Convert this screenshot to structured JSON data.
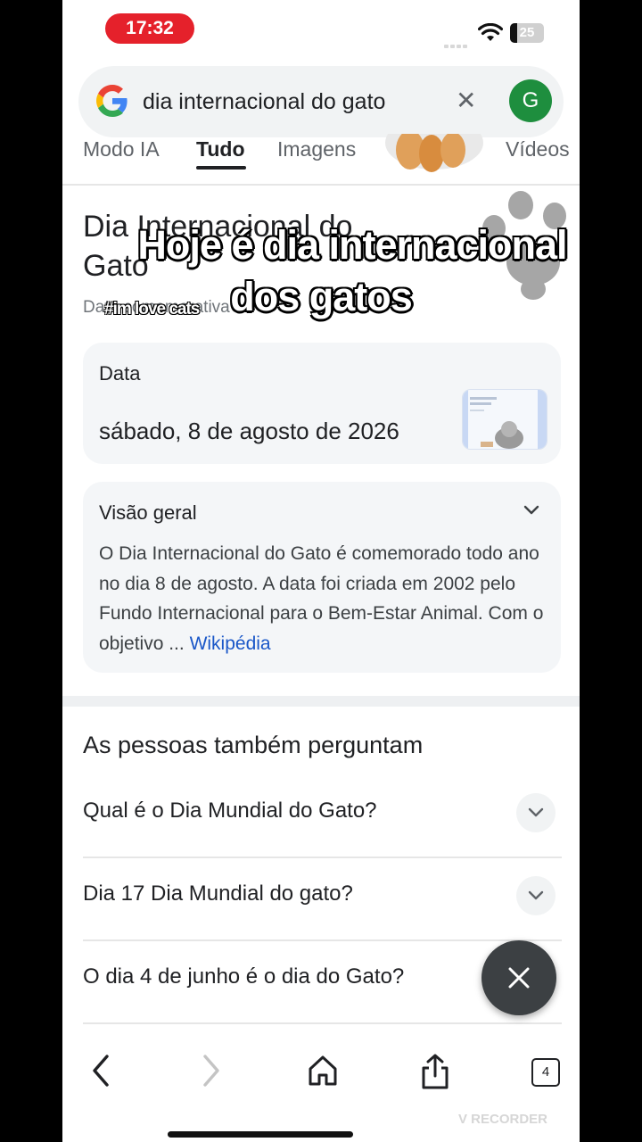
{
  "status_bar": {
    "time": "17:32",
    "battery": "25"
  },
  "search": {
    "query": "dia internacional do gato",
    "avatar_letter": "G"
  },
  "tabs": [
    {
      "label": "Modo IA"
    },
    {
      "label": "Tudo"
    },
    {
      "label": "Imagens"
    },
    {
      "label": "Vídeos"
    }
  ],
  "knowledge_panel": {
    "title": "Dia Internacional do Gato",
    "subtitle": "Data comemorativa"
  },
  "overlay": {
    "caption_line1": "Hoje é dia internacional",
    "caption_line2": "dos gatos",
    "hashtag": "#im love cats"
  },
  "date_card": {
    "label": "Data",
    "value": "sábado, 8 de agosto de 2026"
  },
  "overview": {
    "title": "Visão geral",
    "text": "O Dia Internacional do Gato é comemorado todo ano no dia 8 de agosto. A data foi criada em 2002 pelo Fundo Internacional para o Bem-Estar Animal. Com o objetivo ... ",
    "link": "Wikipédia"
  },
  "people_also_ask": {
    "title": "As pessoas também perguntam",
    "items": [
      {
        "question": "Qual é o Dia Mundial do Gato?"
      },
      {
        "question": "Dia 17 Dia Mundial do gato?"
      },
      {
        "question": "O dia 4 de junho é o dia do Gato?"
      }
    ]
  },
  "bottom_bar": {
    "tab_count": "4"
  },
  "watermark": "V RECORDER",
  "colors": {
    "time_pill": "#e5212b",
    "avatar": "#1e8e3e",
    "link": "#1a57c8"
  }
}
